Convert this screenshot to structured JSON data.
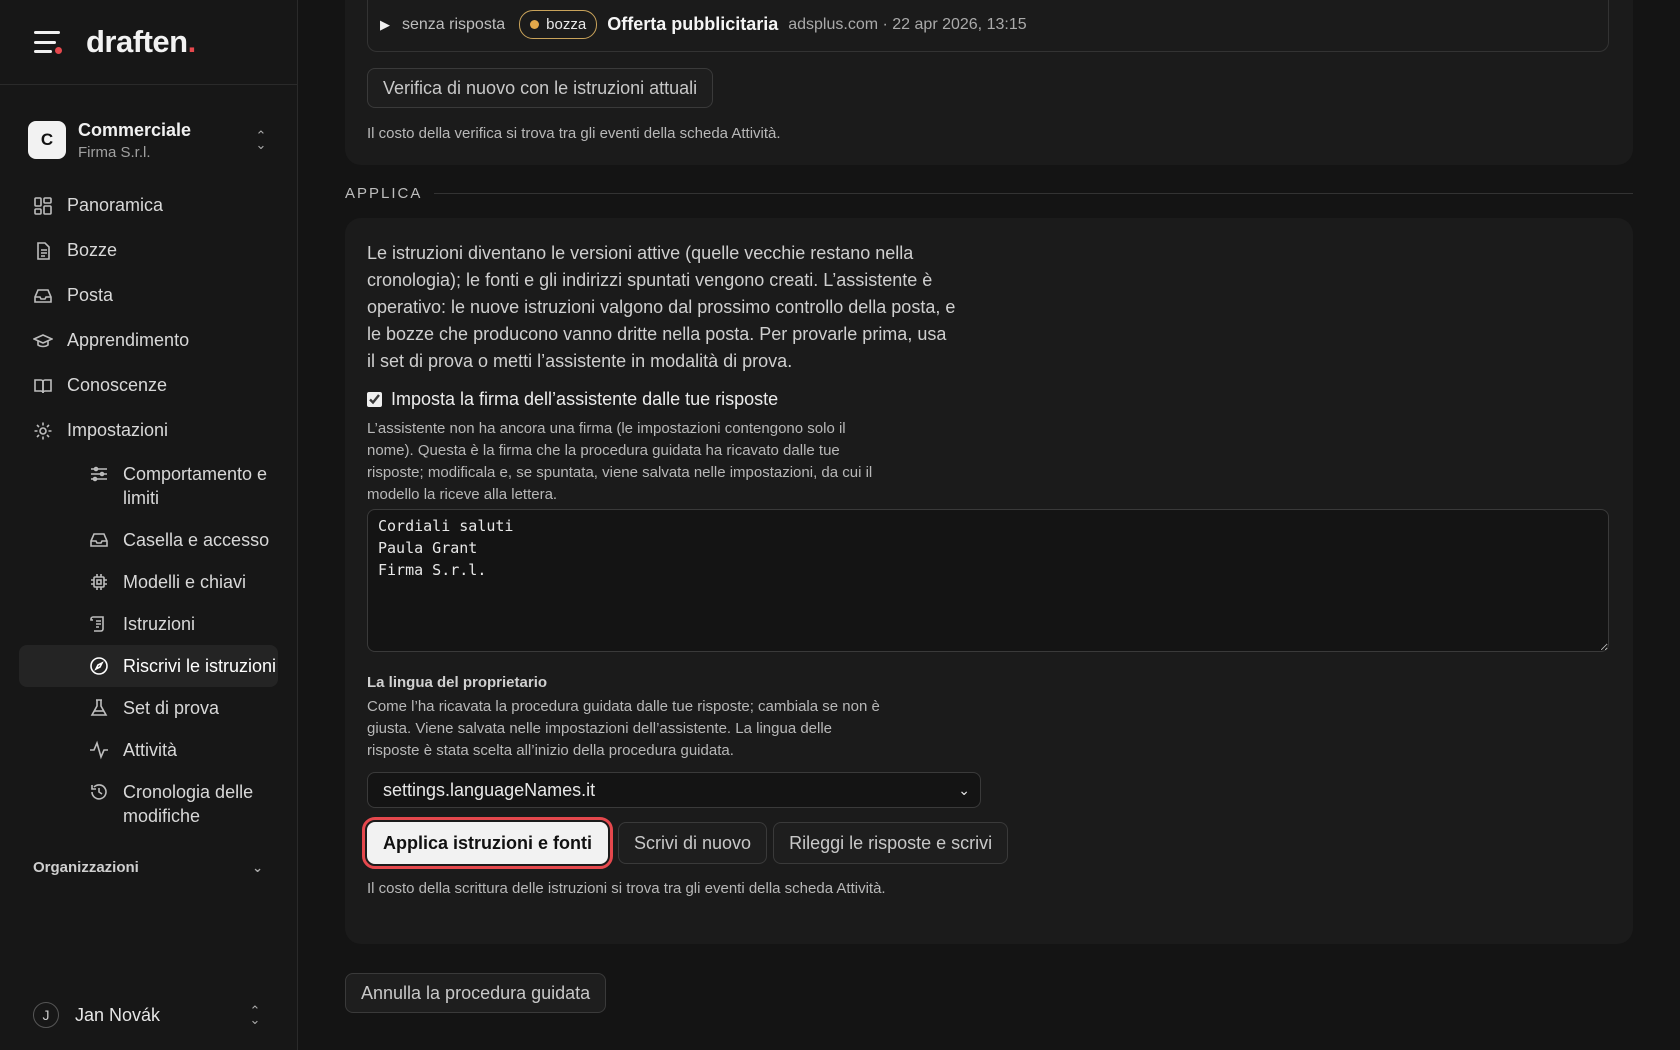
{
  "brand": {
    "logo_text": "draften",
    "logo_dot": "."
  },
  "workspace": {
    "initial": "C",
    "name": "Commerciale",
    "sub": "Firma S.r.l."
  },
  "nav": [
    {
      "label": "Panoramica",
      "icon": "dashboard-icon"
    },
    {
      "label": "Bozze",
      "icon": "document-icon"
    },
    {
      "label": "Posta",
      "icon": "inbox-icon"
    },
    {
      "label": "Apprendimento",
      "icon": "graduation-cap-icon"
    },
    {
      "label": "Conoscenze",
      "icon": "book-icon"
    },
    {
      "label": "Impostazioni",
      "icon": "gear-icon"
    }
  ],
  "subnav": [
    {
      "label": "Comportamento e limiti",
      "icon": "sliders-icon"
    },
    {
      "label": "Casella e accesso",
      "icon": "inbox-icon"
    },
    {
      "label": "Modelli e chiavi",
      "icon": "chip-icon"
    },
    {
      "label": "Istruzioni",
      "icon": "scroll-icon"
    },
    {
      "label": "Riscrivi le istruzioni",
      "icon": "compass-icon",
      "active": true
    },
    {
      "label": "Set di prova",
      "icon": "flask-icon"
    },
    {
      "label": "Attività",
      "icon": "activity-icon"
    },
    {
      "label": "Cronologia delle modifiche",
      "icon": "history-icon"
    }
  ],
  "orgs_label": "Organizzazioni",
  "user": {
    "initial": "J",
    "name": "Jan Novák"
  },
  "top": {
    "status": "senza risposta",
    "badge": "bozza",
    "title": "Offerta pubblicitaria",
    "meta": "adsplus.com · 22 apr 2026, 13:15",
    "verify_button": "Verifica di nuovo con le istruzioni attuali",
    "cost_note": "Il costo della verifica si trova tra gli eventi della scheda Attività."
  },
  "apply": {
    "section_title": "APPLICA",
    "intro": "Le istruzioni diventano le versioni attive (quelle vecchie restano nella cronologia); le fonti e gli indirizzi spuntati vengono creati. L’assistente è operativo: le nuove istruzioni valgono dal prossimo controllo della posta, e le bozze che producono vanno dritte nella posta. Per provarle prima, usa il set di prova o metti l’assistente in modalità di prova.",
    "signature_checkbox": "Imposta la firma dell’assistente dalle tue risposte",
    "signature_help": "L’assistente non ha ancora una firma (le impostazioni contengono solo il nome). Questa è la firma che la procedura guidata ha ricavato dalle tue risposte; modificala e, se spuntata, viene salvata nelle impostazioni, da cui il modello la riceve alla lettera.",
    "signature_value": "Cordiali saluti\nPaula Grant\nFirma S.r.l.",
    "language_label": "La lingua del proprietario",
    "language_help": "Come l’ha ricavata la procedura guidata dalle tue risposte; cambiala se non è giusta. Viene salvata nelle impostazioni dell’assistente. La lingua delle risposte è stata scelta all’inizio della procedura guidata.",
    "language_value": "settings.languageNames.it",
    "apply_button": "Applica istruzioni e fonti",
    "rewrite_button": "Scrivi di nuovo",
    "reread_button": "Rileggi le risposte e scrivi",
    "cost_note": "Il costo della scrittura delle istruzioni si trova tra gli eventi della scheda Attività."
  },
  "cancel_button": "Annulla la procedura guidata",
  "colors": {
    "accent": "#e5484d",
    "badge_dot": "#e3a84a",
    "background": "#141414"
  }
}
